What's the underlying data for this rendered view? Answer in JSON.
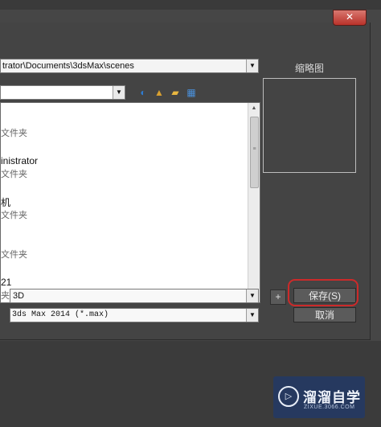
{
  "window": {
    "close_label": "✕"
  },
  "path_bar": {
    "value": "trator\\Documents\\3dsMax\\scenes",
    "dropdown": "▼"
  },
  "location": {
    "value": "",
    "dropdown": "▼"
  },
  "toolbar": {
    "icons": [
      {
        "name": "back-icon",
        "glyph": "◐",
        "color": "#2f7bd0"
      },
      {
        "name": "up-folder-icon",
        "glyph": "▲",
        "color": "#d9a030"
      },
      {
        "name": "new-folder-icon",
        "glyph": "▰",
        "color": "#e8b640"
      },
      {
        "name": "view-menu-icon",
        "glyph": "▦",
        "color": "#4a8fd8"
      }
    ]
  },
  "file_list": {
    "items": [
      {
        "name": "",
        "type": "文件夹"
      },
      {
        "name": "inistrator",
        "type": "文件夹"
      },
      {
        "name": "机",
        "type": "文件夹"
      },
      {
        "name": "",
        "type": "文件夹"
      },
      {
        "name": "21",
        "type": "夹"
      }
    ]
  },
  "thumbnail": {
    "label": "缩略图"
  },
  "file_name": {
    "value": "3D",
    "dropdown": "▼"
  },
  "file_type": {
    "value": "3ds Max 2014 (*.max)",
    "dropdown": "▼"
  },
  "buttons": {
    "plus": "+",
    "save": "保存(S)",
    "cancel": "取消"
  },
  "watermark": {
    "title": "溜溜自学",
    "subtitle": "ZIXUE.3066.COM",
    "logo": "▷"
  }
}
